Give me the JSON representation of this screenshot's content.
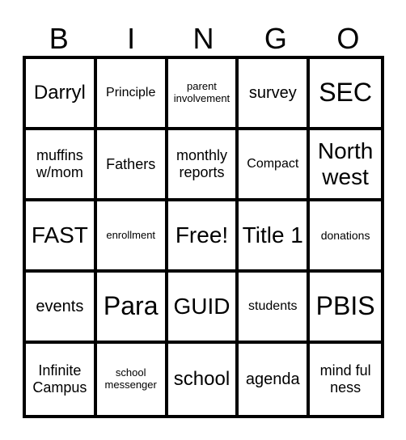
{
  "header": [
    "B",
    "I",
    "N",
    "G",
    "O"
  ],
  "rows": [
    [
      {
        "text": "Darryl",
        "size": "s24"
      },
      {
        "text": "Principle",
        "size": "s16"
      },
      {
        "text": "parent involvement",
        "size": "s13"
      },
      {
        "text": "survey",
        "size": "s20"
      },
      {
        "text": "SEC",
        "size": "s32"
      }
    ],
    [
      {
        "text": "muffins w/mom",
        "size": "s18"
      },
      {
        "text": "Fathers",
        "size": "s18"
      },
      {
        "text": "monthly reports",
        "size": "s18"
      },
      {
        "text": "Compact",
        "size": "s16"
      },
      {
        "text": "North west",
        "size": "s28"
      }
    ],
    [
      {
        "text": "FAST",
        "size": "s28"
      },
      {
        "text": "enrollment",
        "size": "s13"
      },
      {
        "text": "Free!",
        "size": "s28"
      },
      {
        "text": "Title 1",
        "size": "s28"
      },
      {
        "text": "donations",
        "size": "s14"
      }
    ],
    [
      {
        "text": "events",
        "size": "s20"
      },
      {
        "text": "Para",
        "size": "s32"
      },
      {
        "text": "GUID",
        "size": "s28"
      },
      {
        "text": "students",
        "size": "s16"
      },
      {
        "text": "PBIS",
        "size": "s32"
      }
    ],
    [
      {
        "text": "Infinite Campus",
        "size": "s18"
      },
      {
        "text": "school messenger",
        "size": "s13"
      },
      {
        "text": "school",
        "size": "s24"
      },
      {
        "text": "agenda",
        "size": "s20"
      },
      {
        "text": "mind ful ness",
        "size": "s18"
      }
    ]
  ]
}
